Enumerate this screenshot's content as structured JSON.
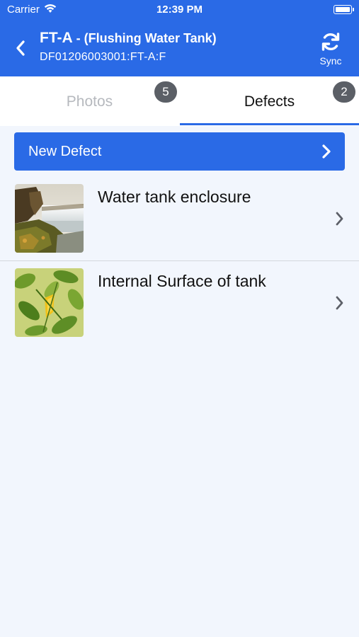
{
  "status_bar": {
    "carrier": "Carrier",
    "time": "12:39 PM"
  },
  "header": {
    "title_main": "FT-A",
    "title_rest": " - (Flushing Water Tank)",
    "subtitle": "DF01206003001:FT-A:F",
    "sync_label": "Sync",
    "back_icon": "chevron-left-icon",
    "sync_icon": "refresh-icon",
    "background_color": "#2a6ae6"
  },
  "tabs": [
    {
      "label": "Photos",
      "badge": "5",
      "active": false
    },
    {
      "label": "Defects",
      "badge": "2",
      "active": true
    }
  ],
  "new_defect": {
    "label": "New Defect"
  },
  "defects": [
    {
      "title": "Water tank enclosure",
      "thumbnail": "waterfall-photo"
    },
    {
      "title": "Internal Surface of tank",
      "thumbnail": "leaves-photo"
    }
  ]
}
